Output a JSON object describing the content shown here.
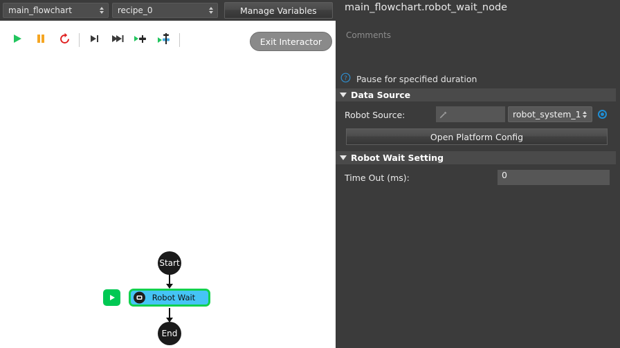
{
  "topbar": {
    "flowchart_select": "main_flowchart",
    "recipe_select": "recipe_0",
    "manage_variables_label": "Manage Variables"
  },
  "toolbar": {
    "buttons": [
      {
        "name": "run-icon",
        "label": "Run"
      },
      {
        "name": "pause-icon",
        "label": "Pause"
      },
      {
        "name": "reset-icon",
        "label": "Reset"
      },
      {
        "name": "step-over-icon",
        "label": "Step Over"
      },
      {
        "name": "step-forward-icon",
        "label": "Step Forward"
      },
      {
        "name": "run-to-node-icon",
        "label": "Run To Node"
      },
      {
        "name": "run-from-node-icon",
        "label": "Run From Node"
      }
    ],
    "exit_interactor_label": "Exit Interactor"
  },
  "flowchart": {
    "start_label": "Start",
    "end_label": "End",
    "selected_node_label": "Robot Wait",
    "run_badge_label": "Run node"
  },
  "panel": {
    "title": "main_flowchart.robot_wait_node",
    "comments_placeholder": "Comments",
    "comments_value": "",
    "hint": "Pause for specified duration",
    "sections": [
      {
        "title": "Data Source"
      },
      {
        "title": "Robot Wait Setting"
      }
    ],
    "robot_source": {
      "label": "Robot Source:",
      "input_value": "",
      "combo_value": "robot_system_1",
      "radio_selected": true
    },
    "open_platform_config_label": "Open Platform Config",
    "time_out": {
      "label": "Time Out (ms):",
      "value": "0"
    }
  },
  "colors": {
    "panel_bg": "#3b3b3b",
    "section_header_bg": "#4a4a4a",
    "canvas_bg": "#ffffff",
    "node_selected_fill": "#45c4f5",
    "node_selected_border": "#12d14f",
    "accent_blue": "#1f8fd6",
    "run_green": "#00c853",
    "pause_orange": "#f5a623",
    "reset_red": "#e02020"
  }
}
